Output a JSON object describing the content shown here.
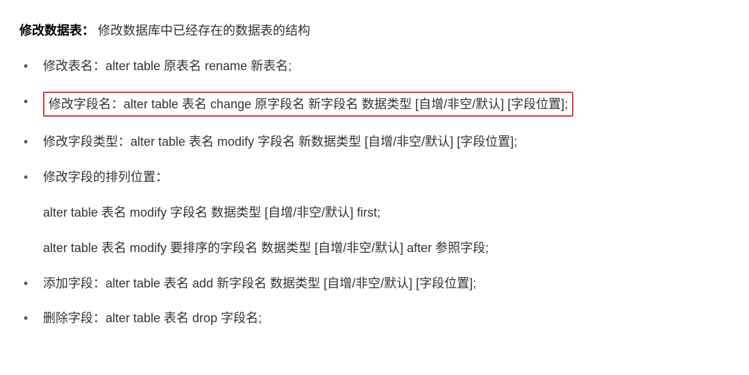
{
  "heading": {
    "title": "修改数据表：",
    "description": "修改数据库中已经存在的数据表的结构"
  },
  "items": [
    {
      "text": "修改表名：alter table 原表名 rename 新表名;",
      "highlighted": false
    },
    {
      "text": "修改字段名：alter table 表名 change 原字段名 新字段名 数据类型 [自增/非空/默认] [字段位置];",
      "highlighted": true
    },
    {
      "text": "修改字段类型：alter table 表名 modify 字段名 新数据类型 [自增/非空/默认] [字段位置];",
      "highlighted": false
    },
    {
      "text": "修改字段的排列位置：",
      "highlighted": false,
      "sublines": [
        "alter table 表名 modify 字段名 数据类型 [自增/非空/默认] first;",
        "alter table 表名 modify 要排序的字段名 数据类型 [自增/非空/默认] after 参照字段;"
      ]
    },
    {
      "text": "添加字段：alter table 表名 add 新字段名 数据类型 [自增/非空/默认] [字段位置];",
      "highlighted": false
    },
    {
      "text": "删除字段：alter table 表名 drop 字段名;",
      "highlighted": false
    }
  ]
}
